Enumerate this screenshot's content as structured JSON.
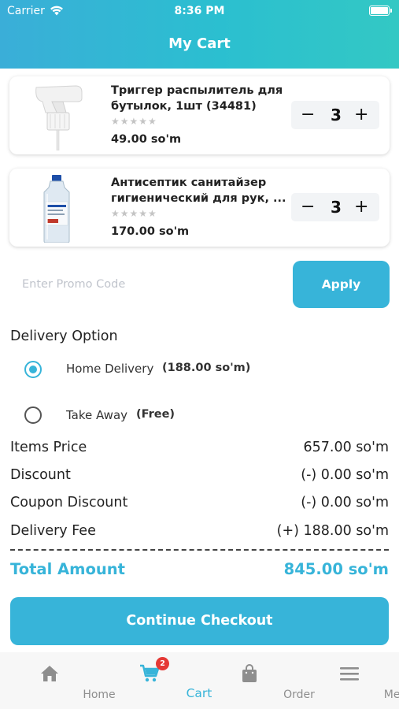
{
  "status_bar": {
    "carrier": "Carrier",
    "time": "8:36 PM"
  },
  "header": {
    "title": "My Cart"
  },
  "cart_items": [
    {
      "name": "Триггер распылитель для бутылок, 1шт (34481)",
      "stars": "★★★★★",
      "rating": 0,
      "price": "49.00 so'm",
      "quantity": "3"
    },
    {
      "name": "Антисептик санитайзер гигиенический для рук, ...",
      "stars": "★★★★★",
      "rating": 0,
      "price": "170.00 so'm",
      "quantity": "3"
    }
  ],
  "promo": {
    "placeholder": "Enter Promo Code",
    "apply_label": "Apply"
  },
  "delivery": {
    "title": "Delivery Option",
    "options": [
      {
        "label": "Home Delivery",
        "extra": "(188.00 so'm)",
        "selected": true
      },
      {
        "label": "Take Away",
        "extra": "(Free)",
        "selected": false
      }
    ]
  },
  "summary": {
    "items_price_label": "Items Price",
    "items_price_value": "657.00 so'm",
    "discount_label": "Discount",
    "discount_value": "(-) 0.00 so'm",
    "coupon_label": "Coupon Discount",
    "coupon_value": "(-) 0.00 so'm",
    "delivery_fee_label": "Delivery Fee",
    "delivery_fee_value": "(+) 188.00 so'm",
    "total_label": "Total Amount",
    "total_value": "845.00 so'm"
  },
  "checkout_label": "Continue Checkout",
  "tabbar": {
    "home": "Home",
    "cart": "Cart",
    "cart_badge": "2",
    "order": "Order",
    "menu": "Menu"
  },
  "colors": {
    "accent": "#37b4d9",
    "badge": "#e53935",
    "header_start": "#3aaed8",
    "header_end": "#33c8c4"
  }
}
